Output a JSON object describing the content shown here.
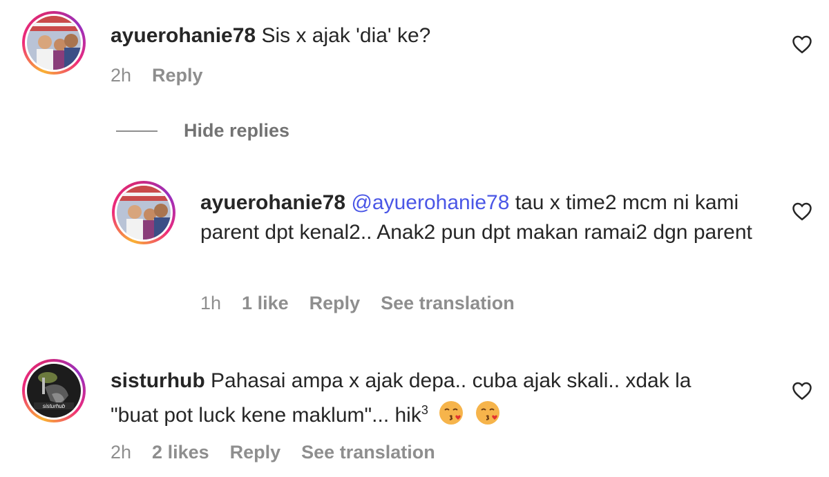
{
  "comments": [
    {
      "username": "ayuerohanie78",
      "text": "Sis x ajak 'dia' ke?",
      "time": "2h",
      "reply_label": "Reply"
    },
    {
      "username": "ayuerohanie78",
      "mention": "@ayuerohanie78",
      "text": "tau x time2 mcm ni kami parent dpt kenal2.. Anak2 pun dpt makan ramai2 dgn parent",
      "time": "1h",
      "likes": "1 like",
      "reply_label": "Reply",
      "translation_label": "See translation"
    },
    {
      "username": "sisturhub",
      "text_line1": "Pahasai ampa x ajak depa.. cuba ajak skali.. xdak la",
      "text_line2": "\"buat pot luck kene maklum\"... hik",
      "superscript": "3",
      "time": "2h",
      "likes": "2 likes",
      "reply_label": "Reply",
      "translation_label": "See translation"
    }
  ],
  "hide_replies_label": "Hide replies",
  "icons": {
    "like": "heart-outline-icon",
    "emoji": "face-blowing-kiss-emoji"
  },
  "colors": {
    "mention": "#4a56e6",
    "meta_text": "#8e8e8e",
    "username": "#262626"
  }
}
